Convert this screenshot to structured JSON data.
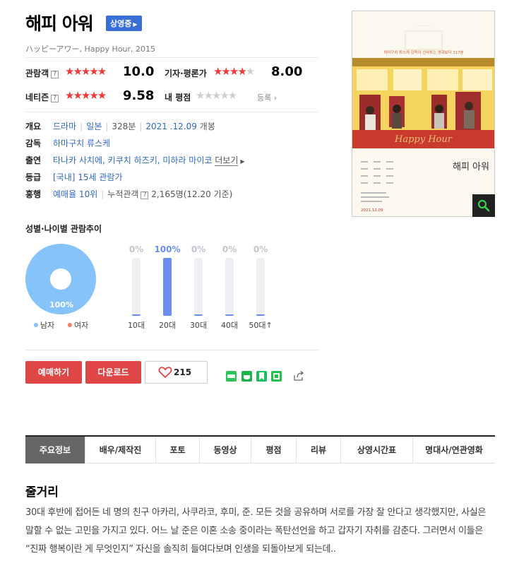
{
  "movie": {
    "title": "해피 아워",
    "status_badge": "상영중",
    "subtitle": "ハッピーアワー, Happy Hour, 2015"
  },
  "ratings": {
    "audience_label": "관람객",
    "audience_score": "10.0",
    "audience_stars": 5,
    "critic_label": "기자·평론가",
    "critic_score": "8.00",
    "critic_stars": 4,
    "netizen_label": "네티즌",
    "netizen_score": "9.58",
    "netizen_stars": 5,
    "my_label": "내 평점",
    "my_register": "등록"
  },
  "info": {
    "overview_label": "개요",
    "genre": "드라마",
    "country": "일본",
    "runtime": "328분",
    "release_date": "2021 .12.09",
    "release_suffix": "개봉",
    "director_label": "감독",
    "director": "하마구치 류스케",
    "cast_label": "출연",
    "cast": "타나카 사치에, 키쿠치 하즈키, 미하라 마이코",
    "cast_more": "더보기",
    "grade_label": "등급",
    "grade": "[국내] 15세 관람가",
    "boxoffice_label": "흥행",
    "booking_rank": "예매율 10위",
    "cumulative_label": "누적관객",
    "cumulative_value": "2,165명(12.20 기준)"
  },
  "poster": {
    "tagline": "하마구치 류스케 감독이 선사하는 영화보다 317분",
    "title_script": "Happy Hour",
    "korean_title": "해피 아워",
    "date": "2021.12.09"
  },
  "demographics": {
    "section_title": "성별·나이별 관람추이",
    "gender_male_label": "남자",
    "gender_female_label": "여자",
    "male_pct_label": "100%",
    "male_color": "#86c3fb",
    "female_color": "#f47d6b"
  },
  "chart_data": {
    "type": "bar",
    "categories": [
      "10대",
      "20대",
      "30대",
      "40대",
      "50대↑"
    ],
    "values": [
      0,
      100,
      0,
      0,
      0
    ],
    "labels": [
      "0%",
      "100%",
      "0%",
      "0%",
      "0%"
    ],
    "ylim": [
      0,
      100
    ],
    "bar_color": "#6b8ef5"
  },
  "actions": {
    "reserve": "예매하기",
    "download": "다운로드",
    "like_count": "215"
  },
  "tabs": [
    "주요정보",
    "배우/제작진",
    "포토",
    "동영상",
    "평점",
    "리뷰",
    "상영시간표",
    "명대사/연관영화"
  ],
  "synopsis": {
    "title": "줄거리",
    "text": "30대 후반에 접어든 네 명의 친구 아카리, 사쿠라코, 후미, 준. 모든 것을 공유하며 서로를 가장 잘 안다고 생각했지만, 사실은 말할 수 없는 고민을 가지고 있다. 어느 날 준은 이혼 소송 중이라는 폭탄선언을 하고 갑자기 자취를 감춘다. 그러면서 이들은 “진짜 행복이란 게 무엇인지” 자신을 솔직히 들여다보며 인생을 되돌아보게 되는데.."
  }
}
